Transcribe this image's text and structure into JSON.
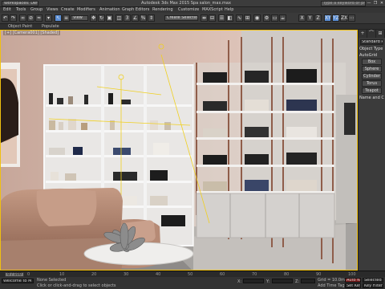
{
  "window": {
    "workspace": "Workspaces: Default",
    "title": "Autodesk 3ds Max 2015   Spa salon_max.max",
    "search_placeholder": "Type a keyword or phrase",
    "controls": [
      "—",
      "❐",
      "✕"
    ]
  },
  "menu": [
    "Edit",
    "Tools",
    "Group",
    "Views",
    "Create",
    "Modifiers",
    "Animation",
    "Graph Editors",
    "Rendering",
    "Customize",
    "MAXScript",
    "Help"
  ],
  "toolbar": {
    "selection_filter": "View",
    "named_selection": "Create Selection Se"
  },
  "ribbon": [
    "Object Paint",
    "Populate"
  ],
  "viewport": {
    "label": "[+] [Camera001] [Shaded]",
    "accent": "#f0c010"
  },
  "command_panel": {
    "tabs": [
      "+",
      "⌒",
      "⊞",
      "◎",
      "▭",
      "⚒"
    ],
    "category": "Standard Primitives",
    "rollout_object_type": "Object Type",
    "autogrid": "AutoGrid",
    "buttons": [
      "Box",
      "Sphere",
      "Cylinder",
      "Torus",
      "Teapot"
    ],
    "rollout_name": "Name and Color"
  },
  "timeline": {
    "slider": "0 / 100",
    "ticks": [
      "0",
      "10",
      "20",
      "30",
      "40",
      "50",
      "60",
      "70",
      "80",
      "90",
      "100"
    ]
  },
  "status": {
    "maxscript": "Welcome to M",
    "selection": "None Selected",
    "prompt": "Click or click-and-drag to select objects",
    "x_label": "X:",
    "y_label": "Y:",
    "z_label": "Z:",
    "grid": "Grid = 10.0mm",
    "autokey": "Auto Key",
    "selected": "Selected",
    "setkey": "Set Key",
    "keyfilters": "Key Filters...",
    "addtime": "Add Time Tag"
  }
}
